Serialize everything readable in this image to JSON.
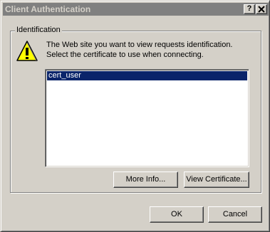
{
  "window": {
    "title": "Client Authentication",
    "help_label": "?",
    "close_label": "x"
  },
  "group": {
    "label": "Identification"
  },
  "message": {
    "line1": "The Web site you want to view requests identification.",
    "line2": "Select the certificate to use when connecting."
  },
  "certificates": {
    "items": [
      "cert_user"
    ],
    "selected": "cert_user"
  },
  "buttons": {
    "more_info": "More Info...",
    "view_certificate": "View Certificate...",
    "ok": "OK",
    "cancel": "Cancel"
  },
  "icons": {
    "warning": "warning-icon"
  },
  "colors": {
    "titlebar_inactive": "#808080",
    "face": "#d4d0c8",
    "selection": "#0a246a",
    "warning_yellow": "#ffff00"
  }
}
